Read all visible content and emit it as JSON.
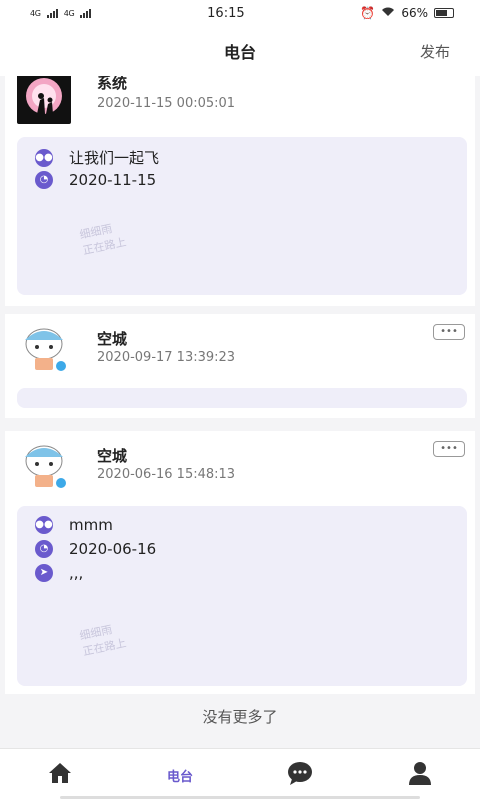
{
  "status_bar": {
    "network_1": "4G",
    "network_2": "4G",
    "time": "16:15",
    "battery": "66%"
  },
  "header": {
    "title": "电台",
    "publish_label": "发布"
  },
  "posts": [
    {
      "author": "系统",
      "time": "2020-11-15 00:05:01",
      "lines": [
        {
          "icon": "mask-icon",
          "text": "让我们一起飞"
        },
        {
          "icon": "clock-icon",
          "text": "2020-11-15"
        }
      ],
      "watermark": [
        "细细雨",
        "正在路上"
      ]
    },
    {
      "author": "空城",
      "time": "2020-09-17 13:39:23",
      "more_label": "•••"
    },
    {
      "author": "空城",
      "time": "2020-06-16 15:48:13",
      "more_label": "•••",
      "lines": [
        {
          "icon": "mask-icon",
          "text": "mmm"
        },
        {
          "icon": "clock-icon",
          "text": "2020-06-16"
        },
        {
          "icon": "location-icon",
          "text": ",,,"
        }
      ],
      "watermark": [
        "细细雨",
        "正在路上"
      ]
    }
  ],
  "footer_text": "没有更多了",
  "tabs": [
    {
      "icon": "home-icon"
    },
    {
      "label": "电台"
    },
    {
      "icon": "chat-icon"
    },
    {
      "icon": "profile-icon"
    }
  ],
  "colors": {
    "accent": "#6a5acd",
    "card_bg": "#efeef9"
  }
}
